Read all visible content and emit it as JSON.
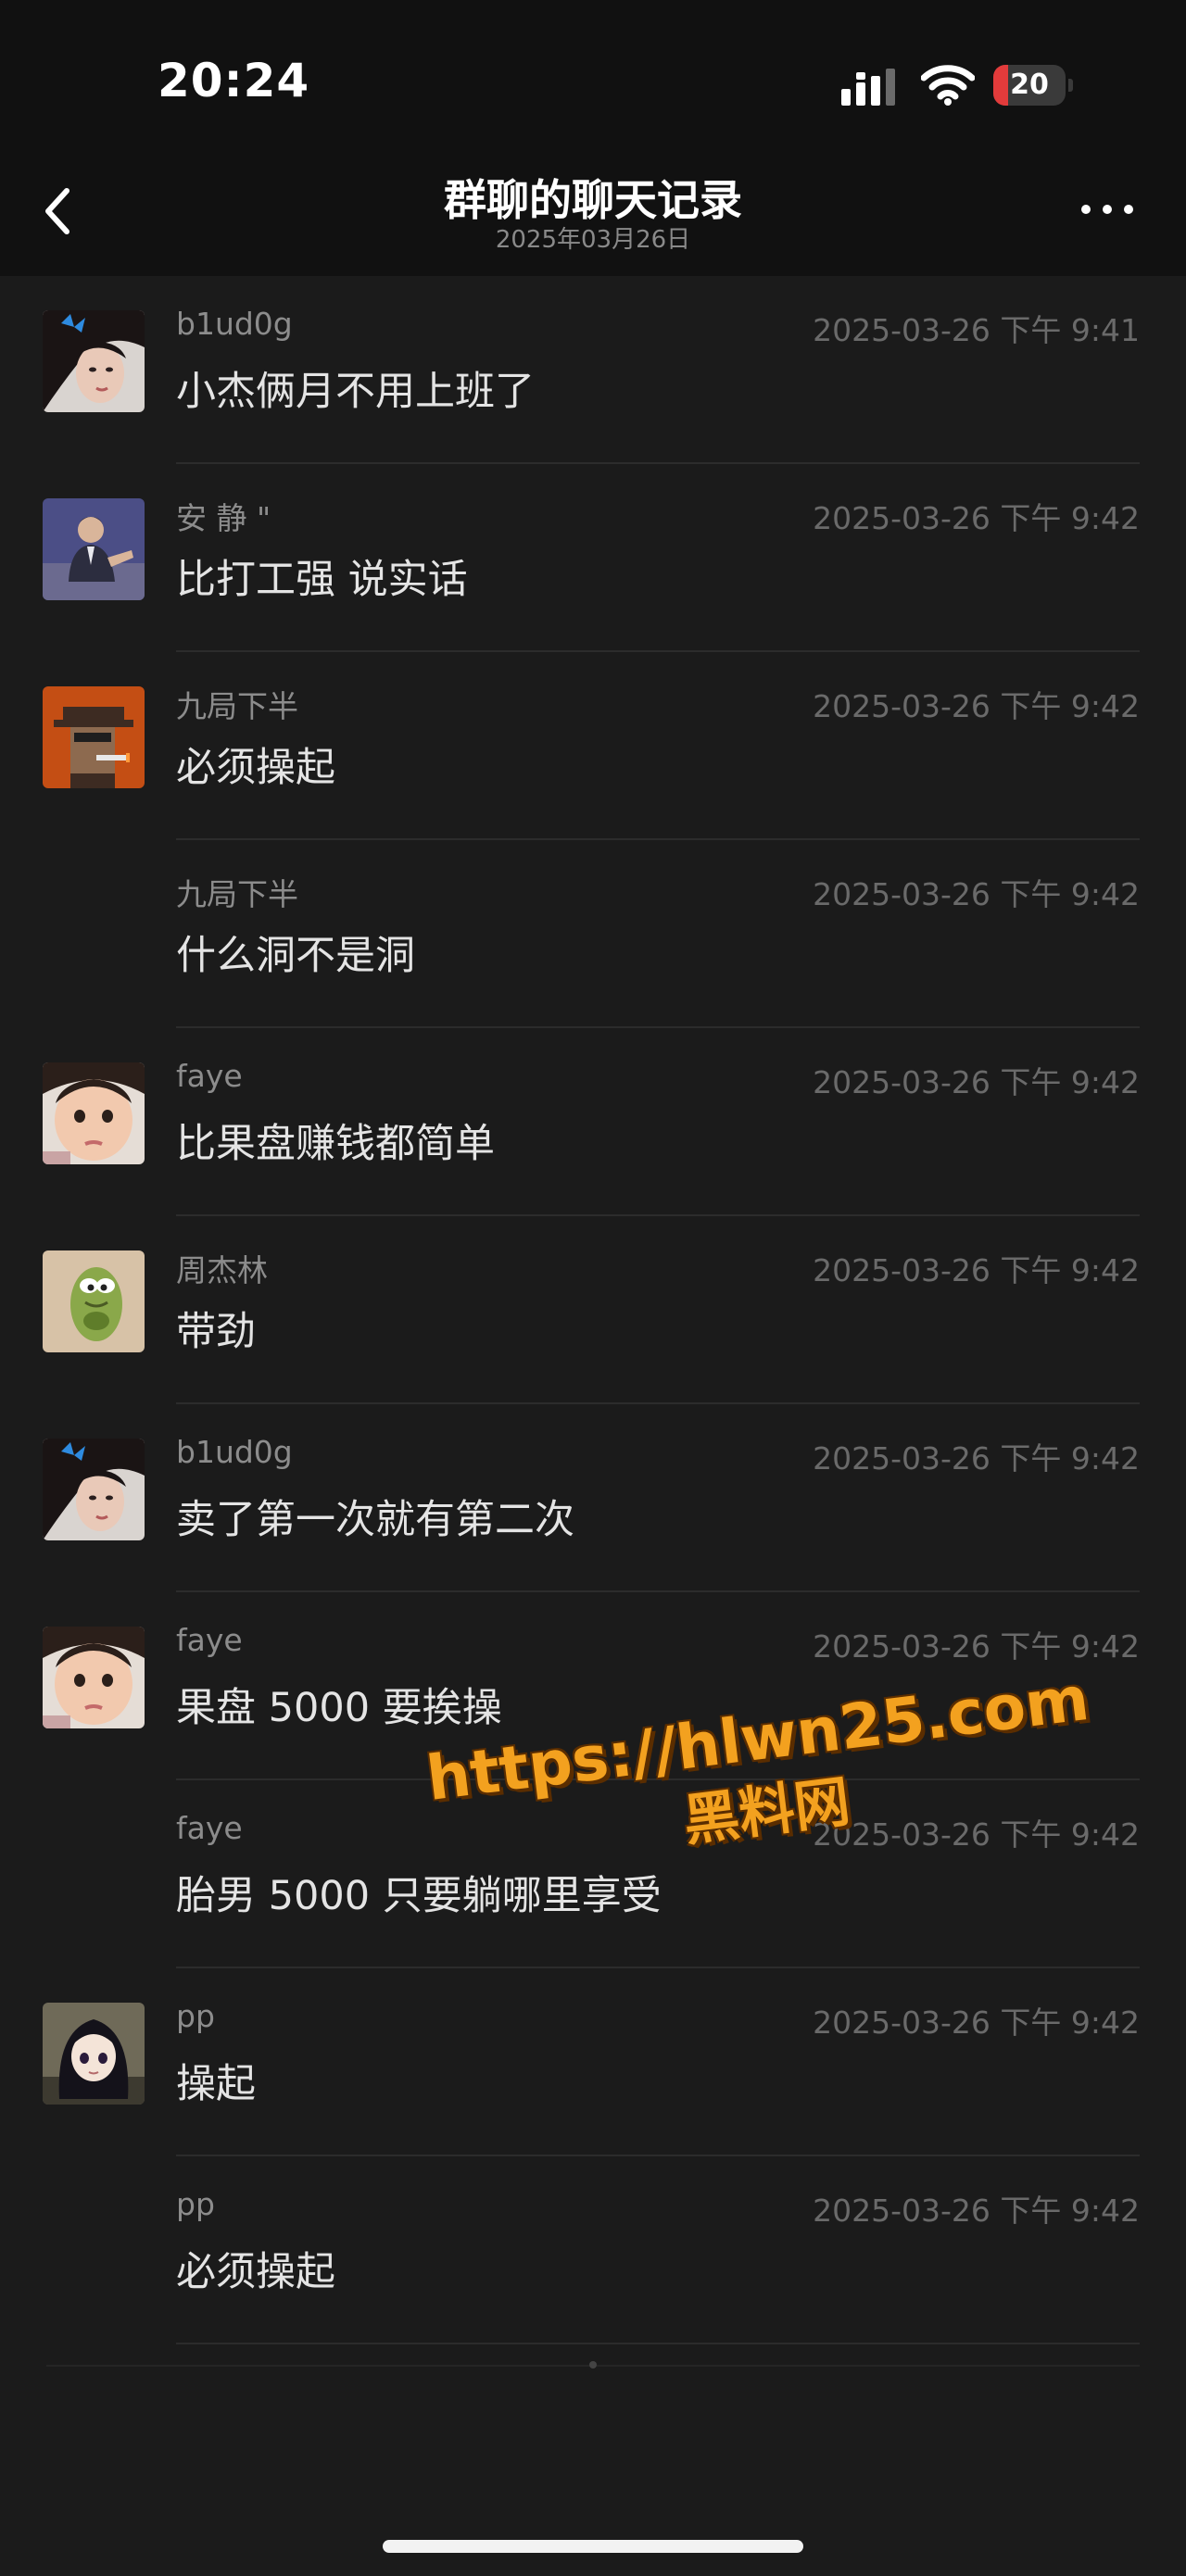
{
  "status_bar": {
    "time": "20:24",
    "battery_level": "20",
    "battery_fraction": 0.2,
    "battery_color": "#e23b3b",
    "icons": [
      "signal-icon",
      "wifi-icon",
      "battery-icon"
    ]
  },
  "nav": {
    "title": "群聊的聊天记录",
    "subtitle": "2025年03月26日",
    "back_icon": "chevron-left-icon",
    "more_icon": "more-dots-icon"
  },
  "messages": [
    {
      "sender": "b1ud0g",
      "time": "2025-03-26 下午 9:41",
      "text": "小杰俩月不用上班了",
      "avatar": "girl-butterfly"
    },
    {
      "sender": "安 静 \"",
      "time": "2025-03-26 下午 9:42",
      "text": "比打工强 说实话",
      "avatar": "man-suit"
    },
    {
      "sender": "九局下半",
      "time": "2025-03-26 下午 9:42",
      "text": "必须操起",
      "avatar": "pixel-detective"
    },
    {
      "sender": "九局下半",
      "time": "2025-03-26 下午 9:42",
      "text": "什么洞不是洞",
      "avatar": ""
    },
    {
      "sender": "faye",
      "time": "2025-03-26 下午 9:42",
      "text": "比果盘赚钱都简单",
      "avatar": "child-face"
    },
    {
      "sender": "周杰林",
      "time": "2025-03-26 下午 9:42",
      "text": "带劲",
      "avatar": "green-creature"
    },
    {
      "sender": "b1ud0g",
      "time": "2025-03-26 下午 9:42",
      "text": "卖了第一次就有第二次",
      "avatar": "girl-butterfly"
    },
    {
      "sender": "faye",
      "time": "2025-03-26 下午 9:42",
      "text": "果盘 5000 要挨操",
      "avatar": "child-face"
    },
    {
      "sender": "faye",
      "time": "2025-03-26 下午 9:42",
      "text": "胎男 5000 只要躺哪里享受",
      "avatar": ""
    },
    {
      "sender": "pp",
      "time": "2025-03-26 下午 9:42",
      "text": "操起",
      "avatar": "anime-girl"
    },
    {
      "sender": "pp",
      "time": "2025-03-26 下午 9:42",
      "text": "必须操起",
      "avatar": ""
    }
  ],
  "watermark": {
    "url": "https://hlwn25.com",
    "site": "黑料网",
    "color": "#f3a11f"
  },
  "colors": {
    "background": "#1b1b1b",
    "header": "#111111",
    "divider": "#2c2c2c"
  }
}
